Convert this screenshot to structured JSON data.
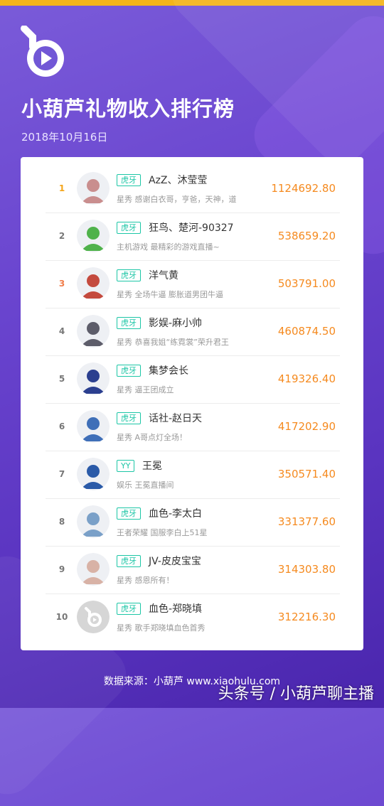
{
  "header": {
    "title": "小葫芦礼物收入排行榜",
    "date": "2018年10月16日"
  },
  "rows": [
    {
      "rank": "1",
      "tag": "虎牙",
      "name": "AzZ、沐莹莹",
      "desc": "星秀 感谢白衣哥，亨爸，天神，道",
      "amount": "1124692.80",
      "avatar": "#c98e8e"
    },
    {
      "rank": "2",
      "tag": "虎牙",
      "name": "狂鸟、楚河-90327",
      "desc": "主机游戏 最精彩的游戏直播~",
      "amount": "538659.20",
      "avatar": "#4fb24b"
    },
    {
      "rank": "3",
      "tag": "虎牙",
      "name": "洋气黄",
      "desc": "星秀 全场牛逼 膨胀道男团牛逼",
      "amount": "503791.00",
      "avatar": "#c44a3e"
    },
    {
      "rank": "4",
      "tag": "虎牙",
      "name": "影娱-麻小帅",
      "desc": "星秀 恭喜我姐“练霓裳”荣升君王",
      "amount": "460874.50",
      "avatar": "#5d5d6a"
    },
    {
      "rank": "5",
      "tag": "虎牙",
      "name": "集梦会长",
      "desc": "星秀 逼王团成立",
      "amount": "419326.40",
      "avatar": "#2b3f8f"
    },
    {
      "rank": "6",
      "tag": "虎牙",
      "name": "话社-赵日天",
      "desc": "星秀 A哥点灯全场！",
      "amount": "417202.90",
      "avatar": "#3f6fb8"
    },
    {
      "rank": "7",
      "tag": "YY",
      "name": "王冕",
      "desc": "娱乐 王冕直播间",
      "amount": "350571.40",
      "avatar": "#2a5aa8"
    },
    {
      "rank": "8",
      "tag": "虎牙",
      "name": "血色-李太白",
      "desc": "王者荣耀 国服李白上51星",
      "amount": "331377.60",
      "avatar": "#7aa0c8"
    },
    {
      "rank": "9",
      "tag": "虎牙",
      "name": "JV-皮皮宝宝",
      "desc": "星秀 感恩所有！",
      "amount": "314303.80",
      "avatar": "#d8b2a6"
    },
    {
      "rank": "10",
      "tag": "虎牙",
      "name": "血色-郑晓填",
      "desc": "星秀 歌手郑晓填血色首秀",
      "amount": "312216.30",
      "avatar": "#cfcfcf"
    }
  ],
  "footer": {
    "source": "数据来源：小葫芦 www.xiaohulu.com",
    "watermark": "头条号 / 小葫芦聊主播"
  },
  "colors": {
    "accent_orange": "#f58a1f",
    "tag_green": "#1cc6a6",
    "top_bar": "#f4b41a"
  }
}
